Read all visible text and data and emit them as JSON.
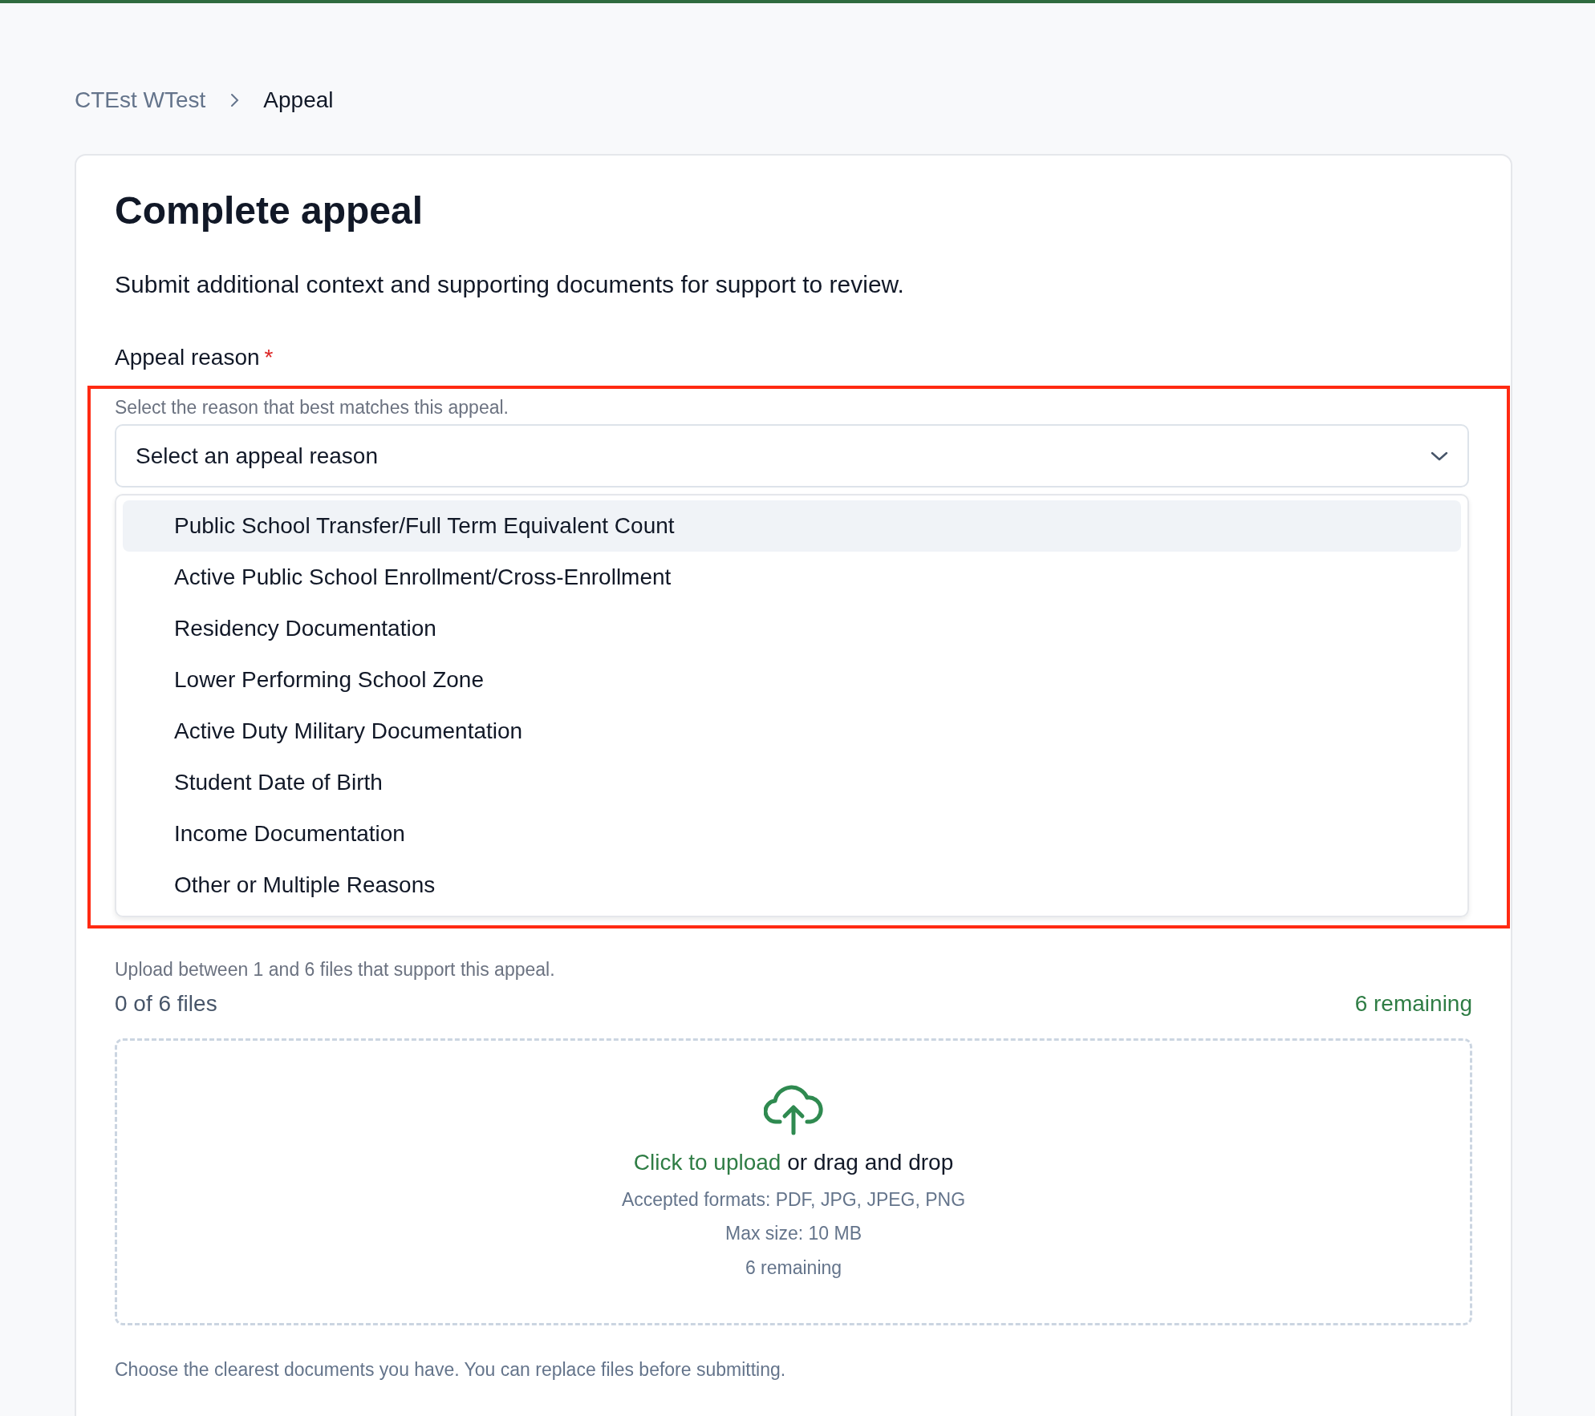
{
  "breadcrumb": [
    {
      "label": "CTEst WTest",
      "current": false
    },
    {
      "label": "Appeal",
      "current": true
    }
  ],
  "title": "Complete appeal",
  "subtitle": "Submit additional context and supporting documents for support to review.",
  "appeal_reason": {
    "label": "Appeal reason",
    "required_marker": "*",
    "help": "Select the reason that best matches this appeal.",
    "placeholder": "Select an appeal reason",
    "expanded": true,
    "options": [
      {
        "label": "Public School Transfer/Full Term Equivalent Count",
        "highlighted": true
      },
      {
        "label": "Active Public School Enrollment/Cross-Enrollment",
        "highlighted": false
      },
      {
        "label": "Residency Documentation",
        "highlighted": false
      },
      {
        "label": "Lower Performing School Zone",
        "highlighted": false
      },
      {
        "label": "Active Duty Military Documentation",
        "highlighted": false
      },
      {
        "label": "Student Date of Birth",
        "highlighted": false
      },
      {
        "label": "Income Documentation",
        "highlighted": false
      },
      {
        "label": "Other or Multiple Reasons",
        "highlighted": false
      }
    ]
  },
  "documents": {
    "help": "Upload between 1 and 6 files that support this appeal.",
    "count": "0 of 6 files",
    "remaining": "6 remaining",
    "dropzone": {
      "link": "Click to upload",
      "text": "or drag and drop",
      "formats": "Accepted formats: PDF, JPG, JPEG, PNG",
      "max_size": "Max size: 10 MB",
      "remaining": "6 remaining"
    },
    "note": "Choose the clearest documents you have. You can replace files before submitting."
  }
}
